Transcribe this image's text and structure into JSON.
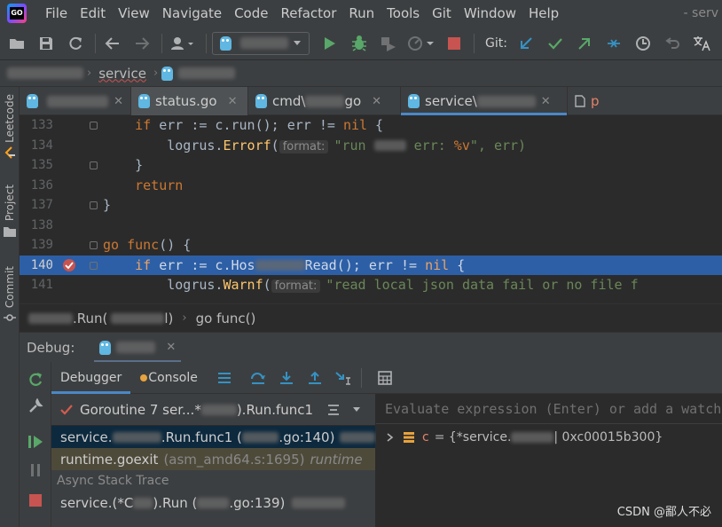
{
  "menu": {
    "items": [
      "File",
      "Edit",
      "View",
      "Navigate",
      "Code",
      "Refactor",
      "Run",
      "Tools",
      "Git",
      "Window",
      "Help"
    ],
    "window_title": "- serv"
  },
  "toolbar": {
    "git_label": "Git:",
    "icons": [
      "folder-icon",
      "save-icon",
      "sync-icon",
      "back-icon",
      "forward-icon",
      "user-icon",
      "run-icon",
      "debug-icon",
      "coverage-icon",
      "profile-icon",
      "stop-icon"
    ]
  },
  "breadcrumb": {
    "item": "service"
  },
  "left_strip": {
    "tabs": [
      "Leetcode",
      "Project",
      "Commit"
    ]
  },
  "editor_tabs": [
    {
      "label": "",
      "active": false
    },
    {
      "label": "status.go",
      "active": true
    },
    {
      "label": "cmd\\",
      "suffix": "go",
      "active": false
    },
    {
      "label": "service\\",
      "active": false,
      "selected": true
    },
    {
      "label": "p",
      "active": false
    }
  ],
  "code": {
    "lines": [
      {
        "no": "133"
      },
      {
        "no": "134"
      },
      {
        "no": "135"
      },
      {
        "no": "136"
      },
      {
        "no": "137"
      },
      {
        "no": "138"
      },
      {
        "no": "139"
      },
      {
        "no": "140"
      },
      {
        "no": "141"
      }
    ],
    "hint_format": "format:",
    "str_run_1": "\"run ",
    "str_run_2": " err: ",
    "str_run_fmt": "%v",
    "str_run_3": "\", err)",
    "str_read": "\"read local json data fail or no file f"
  },
  "code_footer": {
    "left": ".Run(",
    "left_end": "l)",
    "func": "go func()"
  },
  "debug": {
    "title": "Debug:",
    "tabs": {
      "debugger": "Debugger",
      "console": "Console"
    },
    "goroutine": "Goroutine 7 ser...*",
    "goroutine_end": ").Run.func1",
    "frames": [
      {
        "prefix": "service.",
        "name": ".Run.func1 (",
        "loc": ".go:140)"
      },
      {
        "name": "runtime.goexit",
        "loc": "(asm_amd64.s:1695)",
        "tag": "runtime"
      }
    ],
    "async_header": "Async Stack Trace",
    "async_frame": {
      "prefix": "service.(*C",
      "name": ").Run (",
      "loc": ".go:139)"
    },
    "eval_placeholder": "Evaluate expression (Enter) or add a watch",
    "variables": [
      {
        "name": "c",
        "value": "= {*service.",
        "value_end": "| 0xc00015b300}"
      }
    ]
  },
  "watermark": "CSDN @鄙人不必"
}
